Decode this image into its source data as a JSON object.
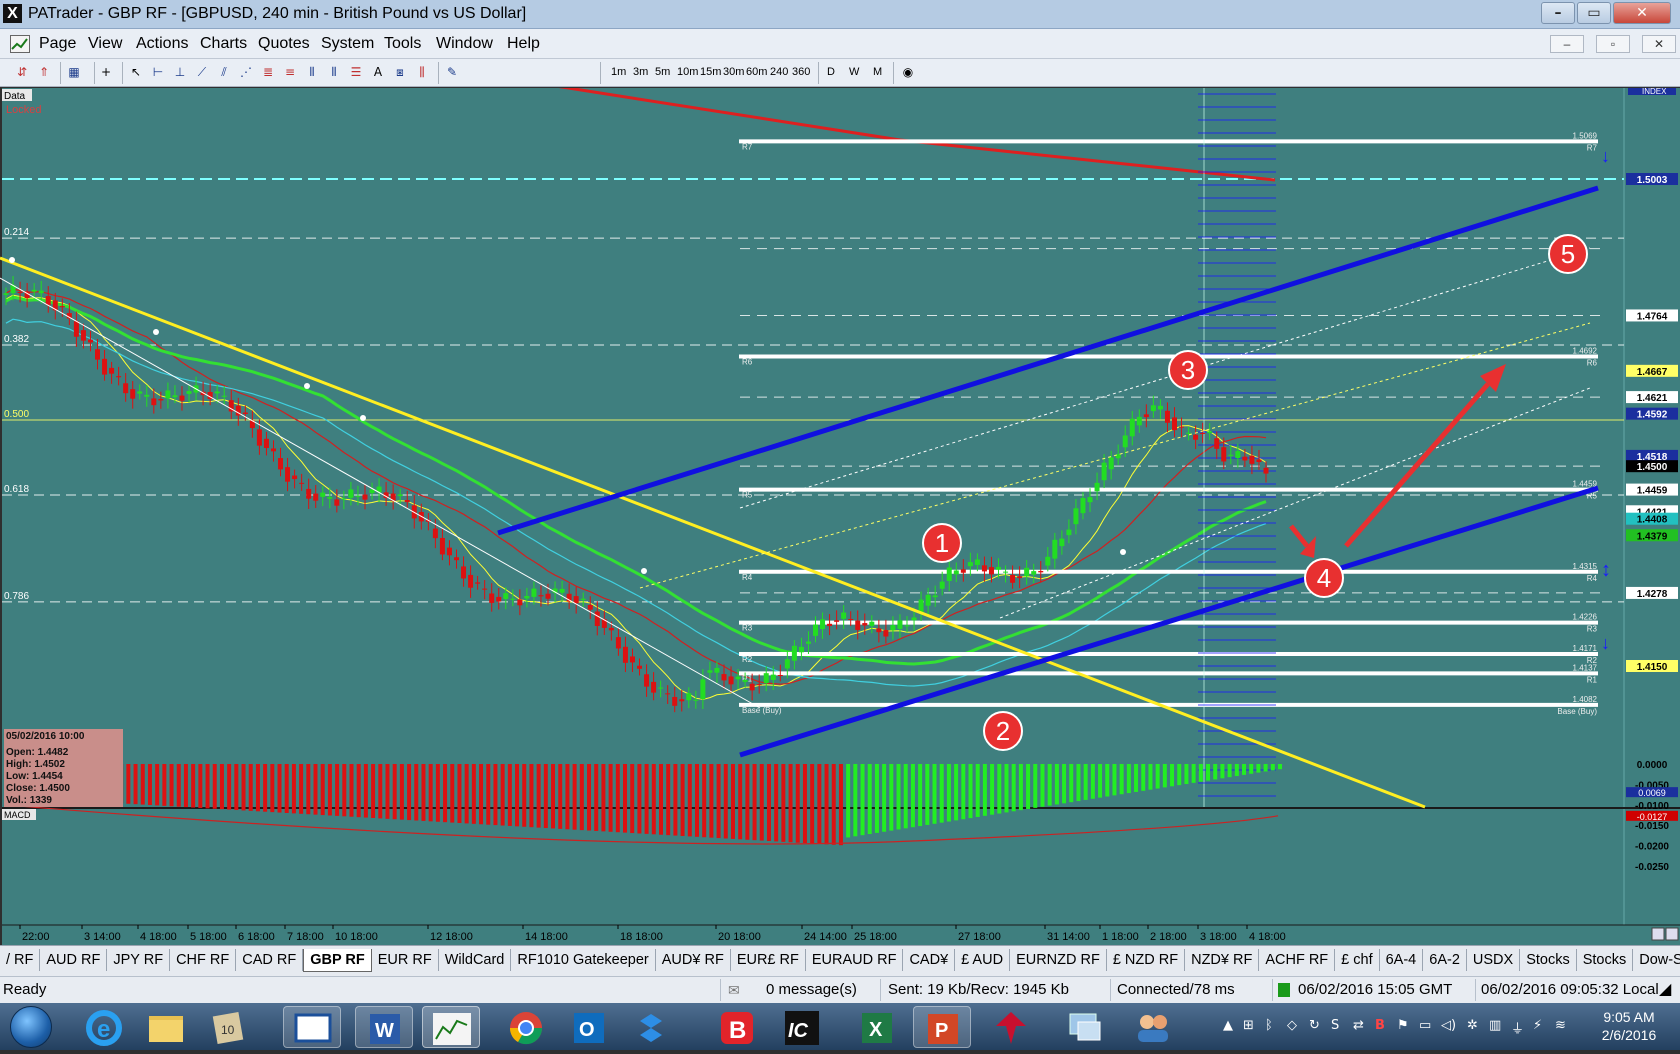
{
  "window": {
    "logo": "X",
    "title": "PATrader - GBP RF - [GBPUSD, 240 min - British Pound vs US Dollar]",
    "min_label": "–",
    "max_label": "▭",
    "close_label": "✕",
    "mdi_min": "–",
    "mdi_restore": "▫",
    "mdi_close": "✕"
  },
  "menu": {
    "items": [
      "Page",
      "View",
      "Actions",
      "Charts",
      "Quotes",
      "System",
      "Tools",
      "Window",
      "Help"
    ]
  },
  "toolbar": {
    "timeframes": [
      "1m",
      "3m",
      "5m",
      "10m",
      "15m",
      "30m",
      "60m",
      "240",
      "360",
      "D",
      "W",
      "M"
    ]
  },
  "chart": {
    "data_label": "Data",
    "locked_label": "Locked",
    "index_label": "INDEX",
    "fib_labels": [
      {
        "text": "0.214",
        "y": 0.214
      },
      {
        "text": "0.382",
        "y": 0.382
      },
      {
        "text": "0.500",
        "y": 0.5
      },
      {
        "text": "0.618",
        "y": 0.618
      },
      {
        "text": "0.786",
        "y": 0.786
      }
    ],
    "price_labels": [
      {
        "text": "1.5003",
        "bg": "#1b2f9e",
        "fg": "#ffffff",
        "price": 1.5003
      },
      {
        "text": "1.4764",
        "bg": "#ffffff",
        "fg": "#000000",
        "price": 1.4764
      },
      {
        "text": "1.4667",
        "bg": "#ffff66",
        "fg": "#000000",
        "price": 1.4667
      },
      {
        "text": "1.4621",
        "bg": "#ffffff",
        "fg": "#000000",
        "price": 1.4621
      },
      {
        "text": "1.4592",
        "bg": "#1b2f9e",
        "fg": "#ffffff",
        "price": 1.4592
      },
      {
        "text": "1.4518",
        "bg": "#1b2f9e",
        "fg": "#ffffff",
        "price": 1.4518
      },
      {
        "text": "1.4500",
        "bg": "#000000",
        "fg": "#ffffff",
        "price": 1.45
      },
      {
        "text": "1.4459",
        "bg": "#ffffff",
        "fg": "#000000",
        "price": 1.4459
      },
      {
        "text": "1.4421",
        "bg": "#ffffff",
        "fg": "#000000",
        "price": 1.4421
      },
      {
        "text": "1.4408",
        "bg": "#22c0c0",
        "fg": "#000000",
        "price": 1.4408
      },
      {
        "text": "1.4379",
        "bg": "#22c022",
        "fg": "#000000",
        "price": 1.4379
      },
      {
        "text": "1.4278",
        "bg": "#ffffff",
        "fg": "#000000",
        "price": 1.4278
      },
      {
        "text": "1.4150",
        "bg": "#ffff66",
        "fg": "#000000",
        "price": 1.415
      }
    ],
    "pivot_levels": [
      {
        "name": "R7",
        "value": "1.5069",
        "price": 1.5069
      },
      {
        "name": "R6",
        "value": "1.4692",
        "price": 1.4692
      },
      {
        "name": "R5",
        "value": "1.4459",
        "price": 1.4459
      },
      {
        "name": "R4",
        "value": "1.4315",
        "price": 1.4315
      },
      {
        "name": "R3",
        "value": "1.4226",
        "price": 1.4226
      },
      {
        "name": "R2",
        "value": "1.4171",
        "price": 1.4171
      },
      {
        "name": "R1",
        "value": "1.4137",
        "price": 1.4137
      },
      {
        "name": "Base (Buy)",
        "value": "1.4082",
        "price": 1.4082
      }
    ],
    "annotations": [
      "1",
      "2",
      "3",
      "4",
      "5"
    ],
    "info_box": {
      "date": "05/02/2016 10:00",
      "open": "Open: 1.4482",
      "high": "High: 1.4502",
      "low": "Low: 1.4454",
      "close": "Close: 1.4500",
      "vol": "Vol.: 1339"
    },
    "macd": {
      "label": "MACD",
      "axis_labels": [
        {
          "text": "0.0000",
          "v": 0.0
        },
        {
          "text": "-0.0050",
          "v": -0.005
        },
        {
          "text": "-0.0100",
          "v": -0.01
        },
        {
          "text": "-0.0150",
          "v": -0.015
        },
        {
          "text": "-0.0200",
          "v": -0.02
        },
        {
          "text": "-0.0250",
          "v": -0.025
        }
      ],
      "value_labels": [
        {
          "text": "0.0069",
          "bg": "#1b2f9e",
          "v": -0.0069
        },
        {
          "text": "-0.0127",
          "bg": "#d00000",
          "v": -0.0127
        }
      ]
    },
    "time_labels": [
      "22:00",
      "3 14:00",
      "4 18:00",
      "5 18:00",
      "6 18:00",
      "7 18:00",
      "10 18:00",
      "12 18:00",
      "14 18:00",
      "18 18:00",
      "20 18:00",
      "24 14:00",
      "25 18:00",
      "27 18:00",
      "31 14:00",
      "1 18:00",
      "2 18:00",
      "3 18:00",
      "4 18:00"
    ]
  },
  "tabs": [
    "/ RF",
    "AUD RF",
    "JPY RF",
    "CHF RF",
    "CAD RF",
    "GBP RF",
    "EUR RF",
    "WildCard",
    "RF1010 Gatekeeper",
    "AUD¥ RF",
    "EUR£ RF",
    "EURAUD RF",
    "CAD¥",
    "£ AUD",
    "EURNZD RF",
    "£ NZD RF",
    "NZD¥ RF",
    "ACHF RF",
    "£ chf",
    "6A-4",
    "6A-2",
    "USDX",
    "Stocks",
    "Stocks",
    "Dow-SP"
  ],
  "active_tab": "GBP RF",
  "status": {
    "ready": "Ready",
    "messages": "0 message(s)",
    "traffic": "Sent: 19 Kb/Recv: 1945 Kb",
    "connection": "Connected/78 ms",
    "gmt": "06/02/2016 15:05 GMT",
    "local": "06/02/2016 09:05:32 Local"
  },
  "taskbar": {
    "time": "9:05 AM",
    "date": "2/6/2016"
  },
  "colors": {
    "chart_bg": "#3f7f7f",
    "up_candle": "#22dd22",
    "down_candle": "#dd1111",
    "channel": "#1010e0",
    "yellow_trend": "#ffee22",
    "annotation": "#e83030"
  }
}
